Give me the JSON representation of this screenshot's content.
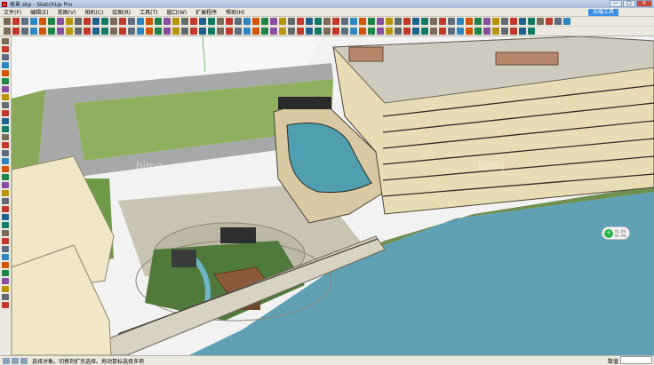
{
  "window": {
    "title": "夜景.skp - SketchUp Pro",
    "min": "—",
    "max": "□",
    "close": "✕"
  },
  "menus": [
    "文件(F)",
    "编辑(E)",
    "视图(V)",
    "相机(C)",
    "绘图(R)",
    "工具(T)",
    "窗口(W)",
    "扩展程序",
    "帮助(H)"
  ],
  "account": {
    "signin_label": "加载工具"
  },
  "toolbar_colors": [
    "#7a6a5a",
    "#c0392b",
    "#5d6d7e",
    "#2e86c1",
    "#d35400",
    "#1e8449",
    "#884ea0",
    "#b7950b",
    "#616a6b",
    "#c0392b",
    "#1f618d",
    "#117a65"
  ],
  "nav": {
    "icon": "zoom-icon",
    "line1": "91.8%",
    "line2": "81.4%"
  },
  "status": {
    "hint": "选择对象。切换到扩充选择。拖动鼠标选择多项",
    "measurements_label": "数值"
  }
}
